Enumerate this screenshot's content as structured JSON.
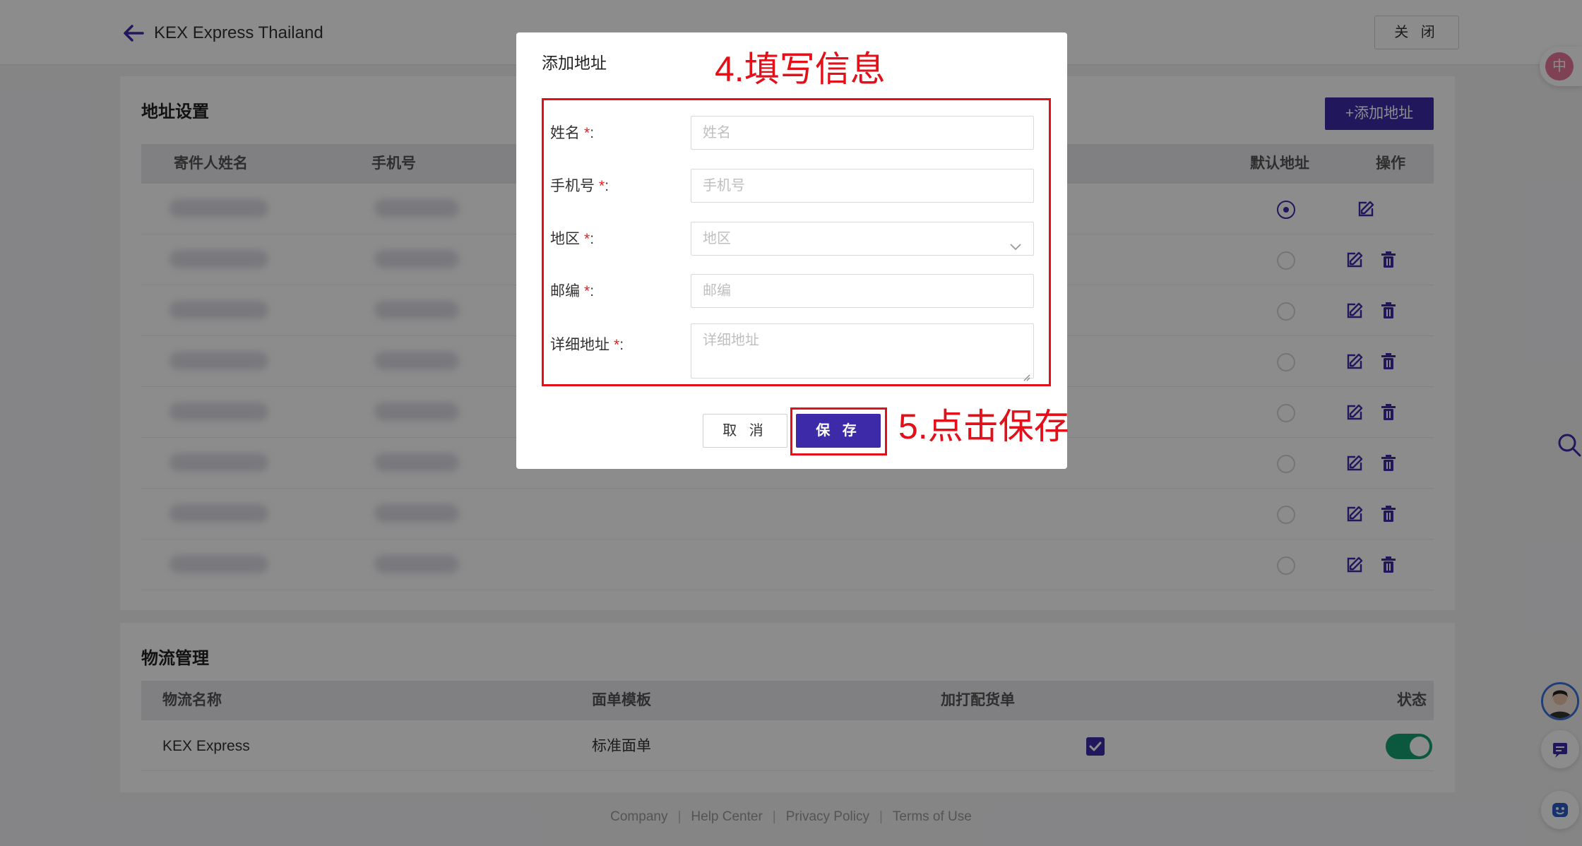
{
  "header": {
    "shop_name": "KEX Express Thailand",
    "close_label": "关 闭"
  },
  "address_section": {
    "title": "地址设置",
    "add_button": "+添加地址",
    "columns": [
      "寄件人姓名",
      "手机号",
      "默认地址",
      "操作"
    ],
    "rows": [
      {
        "default": true,
        "can_delete": false
      },
      {
        "default": false,
        "can_delete": true
      },
      {
        "default": false,
        "can_delete": true
      },
      {
        "default": false,
        "can_delete": true
      },
      {
        "default": false,
        "can_delete": true
      },
      {
        "default": false,
        "can_delete": true
      },
      {
        "default": false,
        "can_delete": true
      },
      {
        "default": false,
        "can_delete": true
      }
    ]
  },
  "logistics_section": {
    "title": "物流管理",
    "columns": [
      "物流名称",
      "面单模板",
      "加打配货单",
      "状态"
    ],
    "row": {
      "name": "KEX Express",
      "template": "标准面单",
      "print_packing_list": true,
      "enabled": true
    }
  },
  "footer": {
    "links": [
      "Company",
      "Help Center",
      "Privacy Policy",
      "Terms of Use"
    ],
    "separator": "|"
  },
  "modal": {
    "title": "添加地址",
    "required_mark": "*",
    "fields": [
      {
        "label": "姓名",
        "placeholder": "姓名"
      },
      {
        "label": "手机号",
        "placeholder": "手机号"
      },
      {
        "label": "地区",
        "placeholder": "地区"
      },
      {
        "label": "邮编",
        "placeholder": "邮编"
      },
      {
        "label": "详细地址",
        "placeholder": "详细地址"
      }
    ],
    "colon": ":",
    "cancel_label": "取 消",
    "save_label": "保 存"
  },
  "annotations": {
    "step4": "4.填写信息",
    "step5": "5.点击保存",
    "color": "#e3101a"
  },
  "side_tools": {
    "translate_glyph": "中"
  },
  "colors": {
    "primary": "#3d2aa8",
    "toggle_on": "#15a071",
    "required": "#e02020"
  }
}
